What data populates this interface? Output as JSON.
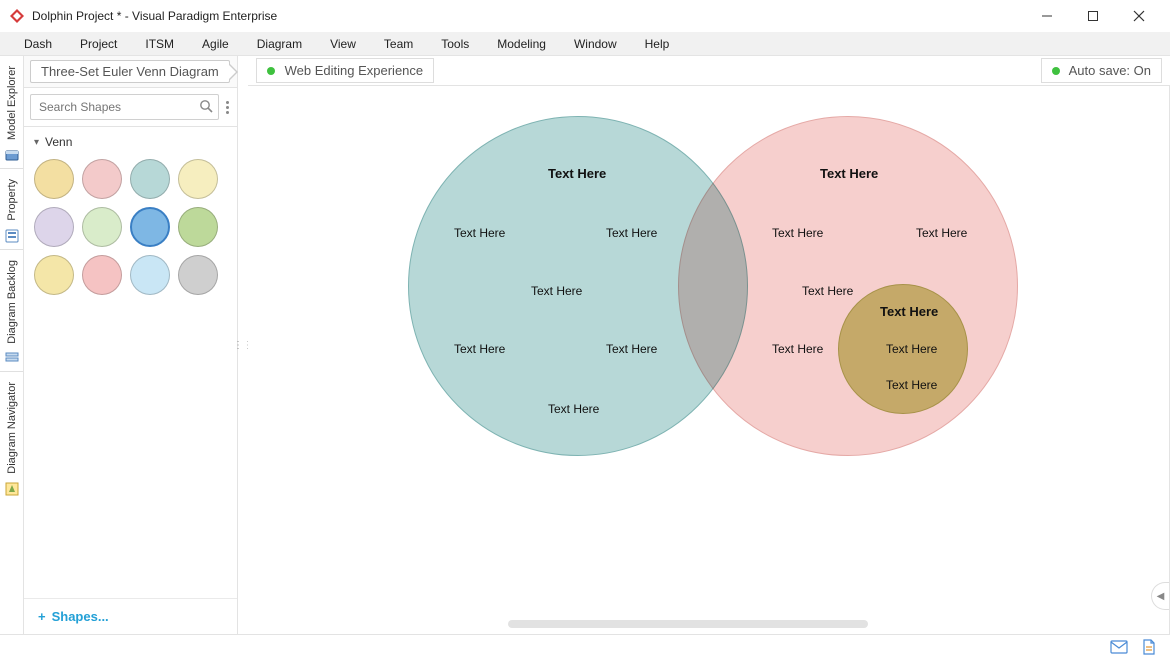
{
  "window": {
    "title": "Dolphin Project * - Visual Paradigm Enterprise"
  },
  "menu": {
    "items": [
      "Dash",
      "Project",
      "ITSM",
      "Agile",
      "Diagram",
      "View",
      "Team",
      "Tools",
      "Modeling",
      "Window",
      "Help"
    ]
  },
  "side_tabs": {
    "items": [
      "Model Explorer",
      "Property",
      "Diagram Backlog",
      "Diagram Navigator"
    ]
  },
  "breadcrumb": {
    "current": "Three-Set Euler Venn Diagram"
  },
  "search": {
    "placeholder": "Search Shapes"
  },
  "shapes": {
    "category": "Venn",
    "link_label": "Shapes...",
    "swatches": [
      "#f3dfa2",
      "#f3caca",
      "#b7d8d7",
      "#f6eebf",
      "#ddd5ea",
      "#d9ecca",
      "#7eb7e4",
      "#bdd99a",
      "#f4e6a8",
      "#f5c3c3",
      "#c9e6f5",
      "#cfcfcf"
    ],
    "swatch_selected_index": 6
  },
  "canvas_header": {
    "doc_status_label": "Web Editing Experience",
    "autosave_label": "Auto save: On"
  },
  "venn": {
    "A": {
      "title": "Text Here",
      "labels": [
        "Text Here",
        "Text Here",
        "Text Here",
        "Text Here",
        "Text Here",
        "Text Here"
      ]
    },
    "B": {
      "title": "Text Here",
      "labels": [
        "Text Here",
        "Text Here",
        "Text Here",
        "Text Here"
      ]
    },
    "C": {
      "title": "Text Here",
      "labels": [
        "Text Here",
        "Text Here"
      ]
    }
  }
}
